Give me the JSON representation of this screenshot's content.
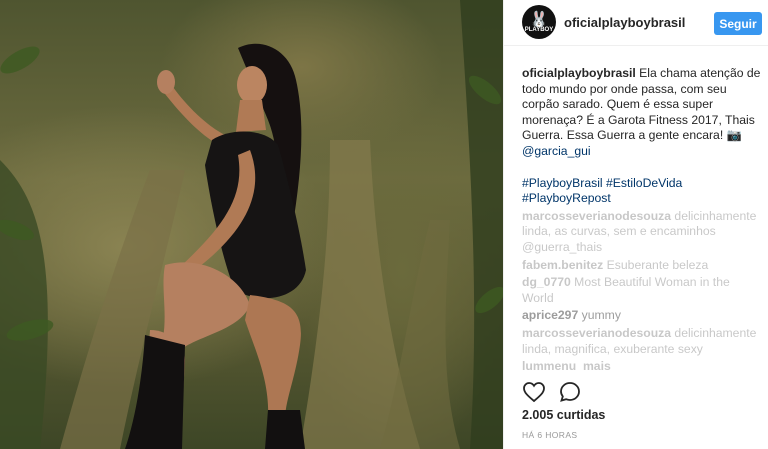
{
  "post": {
    "username": "oficialplayboybrasil",
    "avatar_text": "PLAYBOY",
    "follow_label": "Seguir",
    "caption": {
      "username": "oficialplayboybrasil",
      "text": " Ela chama atenção de todo mundo por onde passa, com seu corpão sarado. Quem é essa super morenaça? É a Garota Fitness 2017, Thais Guerra. Essa Guerra a gente encara! 📷 ",
      "mention": "@garcia_gui"
    },
    "hashtags": "#PlayboyBrasil #EstiloDeVida #PlayboyRepost",
    "comments": [
      {
        "user": "marcosseverianodesouza",
        "text": " delicinhamente linda, as curvas, sem e encaminhos @guerra_thais"
      },
      {
        "user": "fabem.benitez",
        "text": " Esuberante beleza"
      },
      {
        "user": "dg_0770",
        "text": " Most Beautiful Woman in the World"
      },
      {
        "user": "aprice297",
        "text": " yummy"
      },
      {
        "user": "marcosseverianodesouza",
        "text": " delicinhamente linda, magnifica, exuberante sexy"
      },
      {
        "user": "lummenu_mais",
        "text": ""
      }
    ],
    "likes": "2.005 curtidas",
    "time": "HÁ 6 HORAS",
    "icons": {
      "like": "heart-icon",
      "comment": "comment-icon",
      "avatar": "playboy-bunny-icon"
    },
    "colors": {
      "follow": "#3897f0",
      "link": "#003569",
      "divider": "#efefef"
    }
  }
}
